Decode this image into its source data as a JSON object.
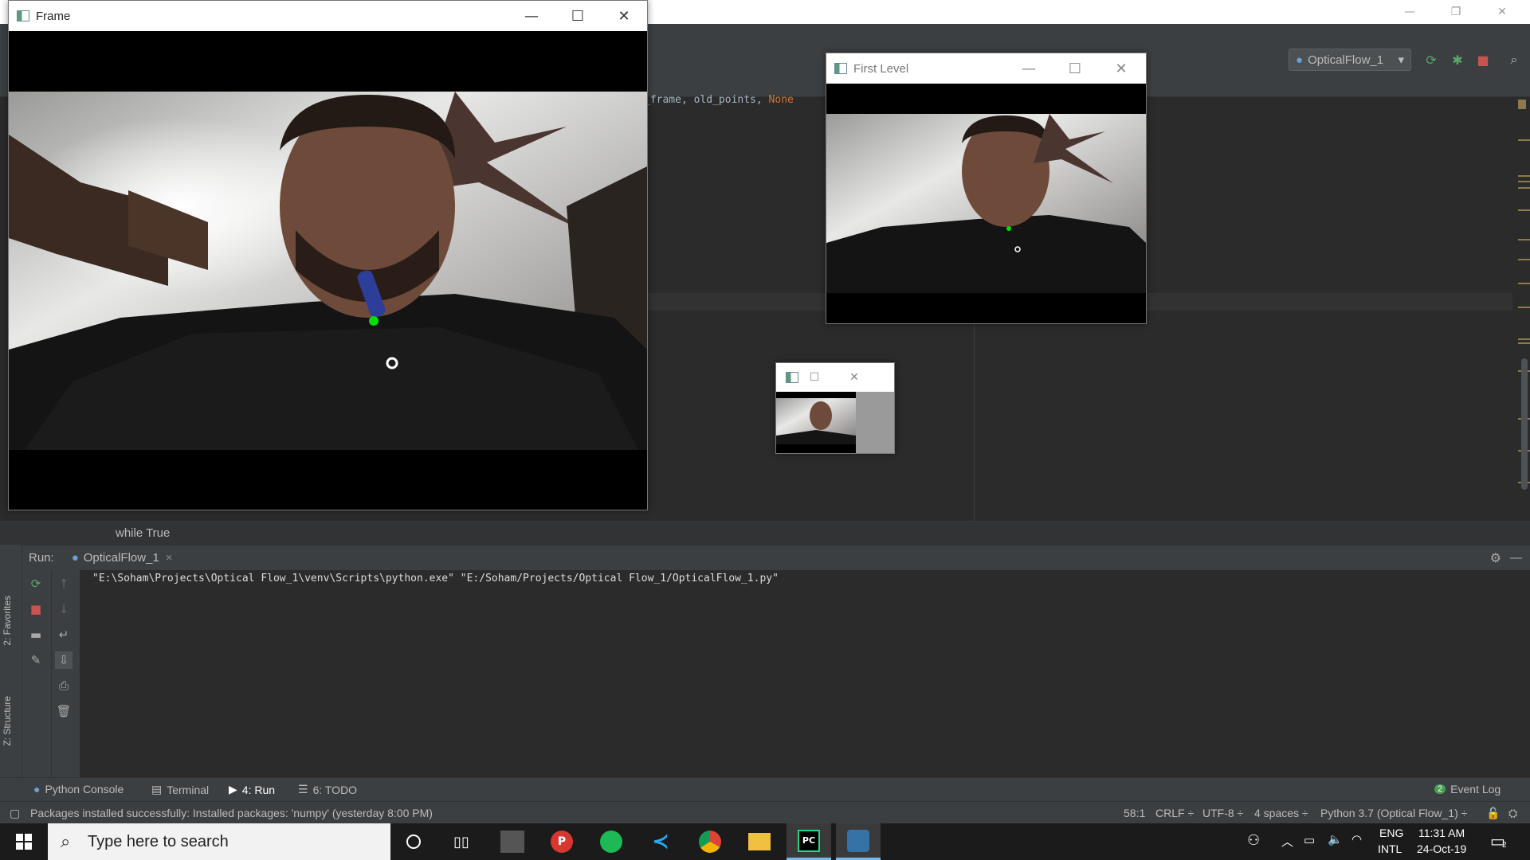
{
  "ide": {
    "run_config": "OpticalFlow_1",
    "code_fragment": "_frame, old_points, ",
    "code_keyword": "None",
    "breadcrumb": "while True",
    "run_label": "Run:",
    "run_tab": "OpticalFlow_1",
    "console_line": "\"E:\\Soham\\Projects\\Optical Flow_1\\venv\\Scripts\\python.exe\" \"E:/Soham/Projects/Optical Flow_1/OpticalFlow_1.py\"",
    "side_tabs": {
      "favorites": "2: Favorites",
      "structure": "Z: Structure"
    },
    "bottom_tabs": [
      "Python Console",
      "Terminal",
      "4: Run",
      "6: TODO"
    ],
    "event_log": "Event Log",
    "event_log_count": "2",
    "status": {
      "message": "Packages installed successfully: Installed packages: 'numpy' (yesterday 8:00 PM)",
      "position": "58:1",
      "line_sep": "CRLF ÷",
      "encoding": "UTF-8 ÷",
      "indent": "4 spaces ÷",
      "interpreter": "Python 3.7 (Optical Flow_1) ÷"
    }
  },
  "windows": {
    "frame": {
      "title": "Frame"
    },
    "first_level": {
      "title": "First Level"
    },
    "third": {
      "title": ""
    }
  },
  "taskbar": {
    "search_placeholder": "Type here to search",
    "lang_top": "ENG",
    "lang_bottom": "INTL",
    "time": "11:31 AM",
    "date": "24-Oct-19",
    "notification_count": "2"
  },
  "colors": {
    "ide_bg": "#2b2b2b",
    "panel_bg": "#3c3f41",
    "tracked_point": "#00e000"
  }
}
